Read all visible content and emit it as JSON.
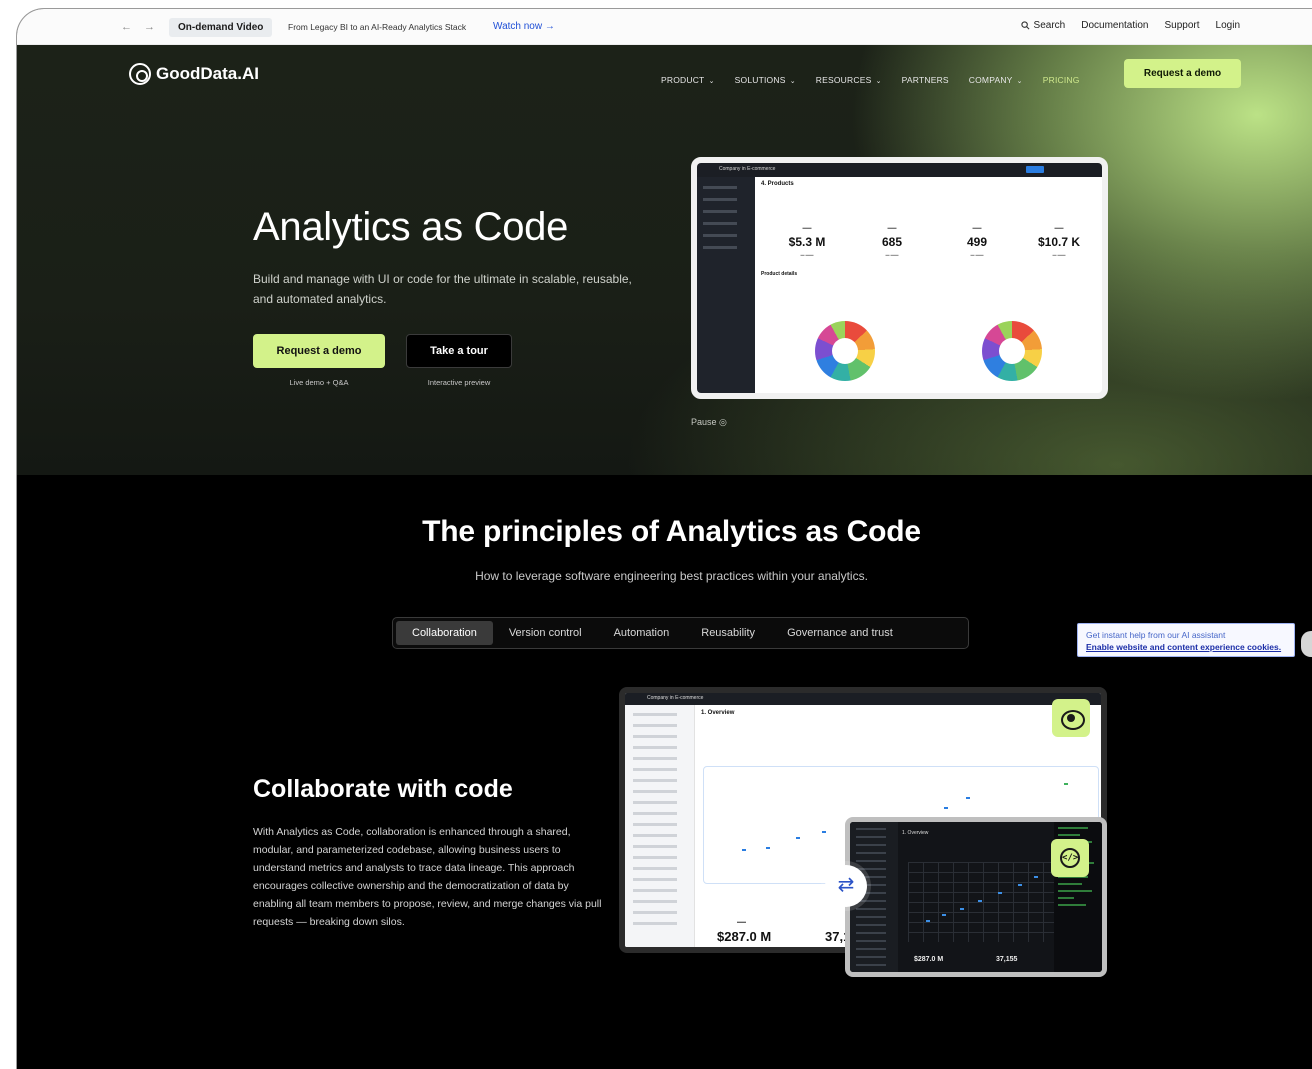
{
  "topbar": {
    "back": "←",
    "forward": "→",
    "badge": "On-demand Video",
    "promo": "From Legacy BI to an AI-Ready Analytics Stack",
    "watch": "Watch now →",
    "search": "Search",
    "documentation": "Documentation",
    "support": "Support",
    "login": "Login"
  },
  "nav": {
    "logo": "GoodData.AI",
    "items": [
      "PRODUCT",
      "SOLUTIONS",
      "RESOURCES",
      "PARTNERS",
      "COMPANY",
      "PRICING"
    ],
    "cta": "Request a demo"
  },
  "hero": {
    "title": "Analytics as Code",
    "subtitle": "Build and manage with UI or code for the ultimate in scalable, reusable, and automated analytics.",
    "primary_button": "Request a demo",
    "primary_caption": "Live demo + Q&A",
    "secondary_button": "Take a tour",
    "secondary_caption": "Interactive preview",
    "pause": "Pause ◎"
  },
  "dashboard_preview": {
    "app_title": "Company in E-commerce",
    "page_title": "4. Products",
    "kpis": [
      "$5.3 M",
      "685",
      "499",
      "$10.7 K"
    ],
    "section": "Product details"
  },
  "principles": {
    "title": "The principles of Analytics as Code",
    "subtitle": "How to leverage software engineering best practices within your analytics.",
    "tabs": [
      "Collaboration",
      "Version control",
      "Automation",
      "Reusability",
      "Governance and trust"
    ],
    "active_tab": "Collaboration"
  },
  "assistant": {
    "line1": "Get instant help from our AI assistant",
    "line2": "Enable website and content experience cookies."
  },
  "collab": {
    "title": "Collaborate with code",
    "body": "With Analytics as Code, collaboration is enhanced through a shared, modular, and parameterized codebase, allowing business users to understand metrics and analysts to trace data lineage. This approach encourages collective ownership and the democratization of data by enabling all team members to propose, review, and merge changes via pull requests — breaking down silos."
  },
  "overview_preview": {
    "app_title": "Company in E-commerce",
    "page_title": "1. Overview",
    "kpi_1": "$287.0 M",
    "kpi_2": "37,1",
    "code_kpi_1": "$287.0 M",
    "code_kpi_2": "37,155"
  },
  "icons": {
    "eye": "eye-icon",
    "code": "code-icon",
    "swap": "swap-icon",
    "search": "search-icon"
  },
  "colors": {
    "accent": "#d3f28a",
    "link": "#1f4fd6"
  }
}
